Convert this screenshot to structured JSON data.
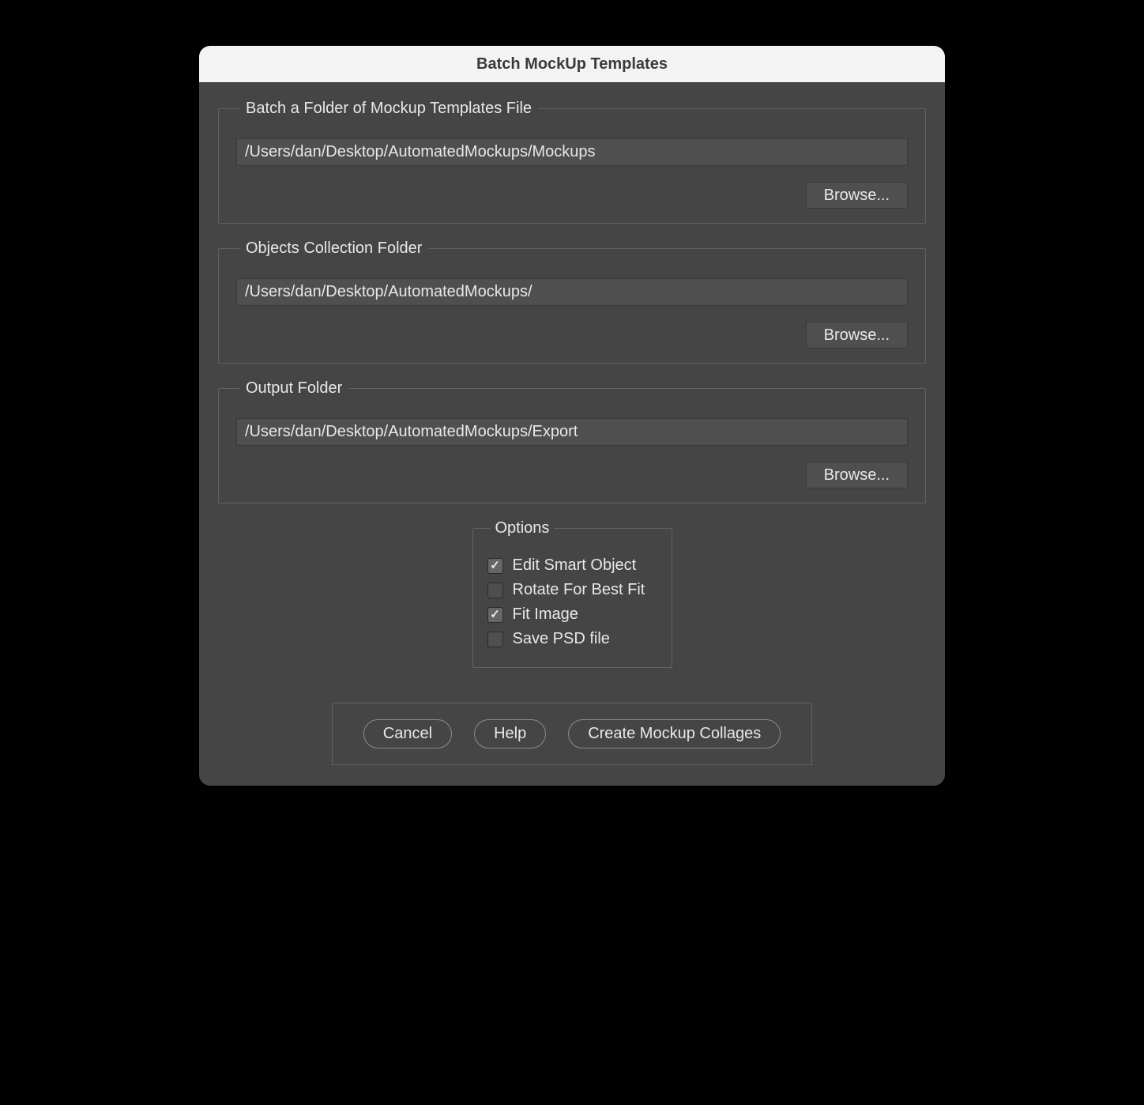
{
  "dialog": {
    "title": "Batch MockUp Templates"
  },
  "sections": {
    "mockupFolder": {
      "legend": "Batch a Folder of Mockup Templates File",
      "value": "/Users/dan/Desktop/AutomatedMockups/Mockups",
      "browseLabel": "Browse..."
    },
    "objectsFolder": {
      "legend": "Objects Collection Folder",
      "value": "/Users/dan/Desktop/AutomatedMockups/",
      "browseLabel": "Browse..."
    },
    "outputFolder": {
      "legend": "Output Folder",
      "value": "/Users/dan/Desktop/AutomatedMockups/Export",
      "browseLabel": "Browse..."
    }
  },
  "options": {
    "legend": "Options",
    "items": [
      {
        "label": "Edit Smart Object",
        "checked": true
      },
      {
        "label": "Rotate For Best Fit",
        "checked": false
      },
      {
        "label": "Fit Image",
        "checked": true
      },
      {
        "label": "Save PSD file",
        "checked": false
      }
    ]
  },
  "footer": {
    "cancel": "Cancel",
    "help": "Help",
    "create": "Create Mockup Collages"
  }
}
